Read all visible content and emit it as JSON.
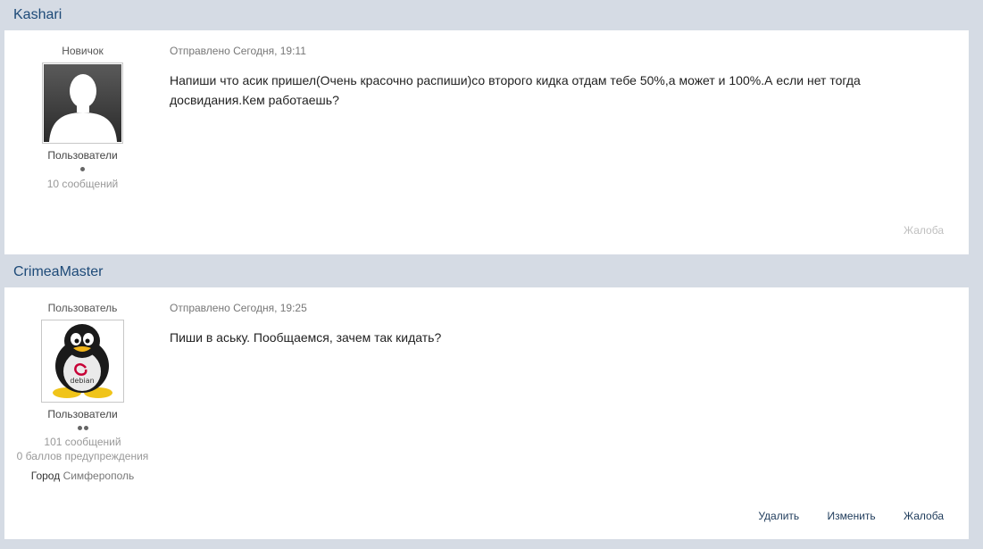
{
  "posts": [
    {
      "username": "Kashari",
      "rank": "Новичок",
      "avatar": "default-silhouette-avatar",
      "group": "Пользователи",
      "reputation_pips": 1,
      "post_count": "10 сообщений",
      "posted": "Отправлено Сегодня, 19:11",
      "message": "Напиши что асик пришел(Очень красочно распиши)со второго кидка отдам тебе 50%,а может и 100%.А если нет тогда досвидания.Кем работаешь?",
      "actions": {
        "report": "Жалоба"
      }
    },
    {
      "username": "CrimeaMaster",
      "rank": "Пользователь",
      "avatar": "debian-penguin-avatar",
      "avatar_text": "debian",
      "group": "Пользователи",
      "reputation_pips": 2,
      "post_count": "101 сообщений",
      "warnings": "0 баллов предупреждения",
      "city_label": "Город",
      "city_value": "Симферополь",
      "posted": "Отправлено Сегодня, 19:25",
      "message": "Пиши в аську. Пообщаемся, зачем так кидать?",
      "actions": {
        "delete": "Удалить",
        "edit": "Изменить",
        "report": "Жалоба"
      }
    }
  ],
  "colors": {
    "header_bg": "#d5dbe4",
    "username": "#1d4a78",
    "body_bg": "#ffffff"
  }
}
